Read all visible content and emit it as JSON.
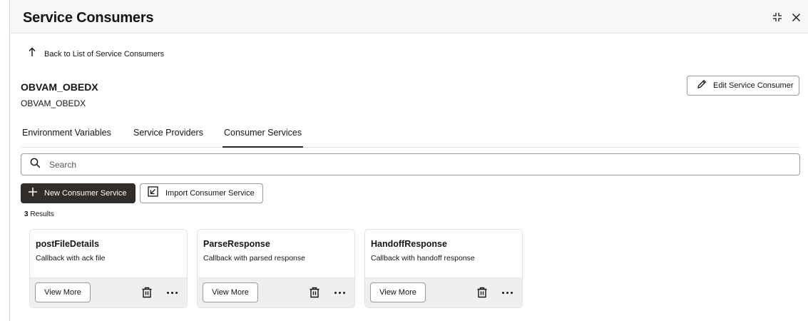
{
  "header": {
    "title": "Service Consumers",
    "icons": [
      "minimize-icon",
      "close-icon"
    ]
  },
  "back_link": {
    "label": "Back to List of Service Consumers",
    "icon": "arrow-up-icon"
  },
  "consumer": {
    "name": "OBVAM_OBEDX",
    "subtitle": "OBVAM_OBEDX"
  },
  "edit_button": {
    "label": "Edit Service Consumer",
    "icon": "pencil-icon"
  },
  "tabs": [
    {
      "label": "Environment Variables",
      "active": false
    },
    {
      "label": "Service Providers",
      "active": false
    },
    {
      "label": "Consumer Services",
      "active": true
    }
  ],
  "search": {
    "placeholder": "Search",
    "value": "",
    "icon": "search-icon"
  },
  "toolbar": {
    "new_label": "New Consumer Service",
    "import_label": "Import Consumer Service"
  },
  "results": {
    "count": "3",
    "label": "Results"
  },
  "cards": [
    {
      "title": "postFileDetails",
      "description": "Callback with ack file",
      "view_label": "View More"
    },
    {
      "title": "ParseResponse",
      "description": "Callback with parsed response",
      "view_label": "View More"
    },
    {
      "title": "HandoffResponse",
      "description": "Callback with handoff response",
      "view_label": "View More"
    }
  ],
  "colors": {
    "primary_button": "#312d2a",
    "header_bg": "#f8f7f6",
    "card_footer_bg": "#f1efed",
    "border": "#9e9a95",
    "text": "#161513"
  }
}
